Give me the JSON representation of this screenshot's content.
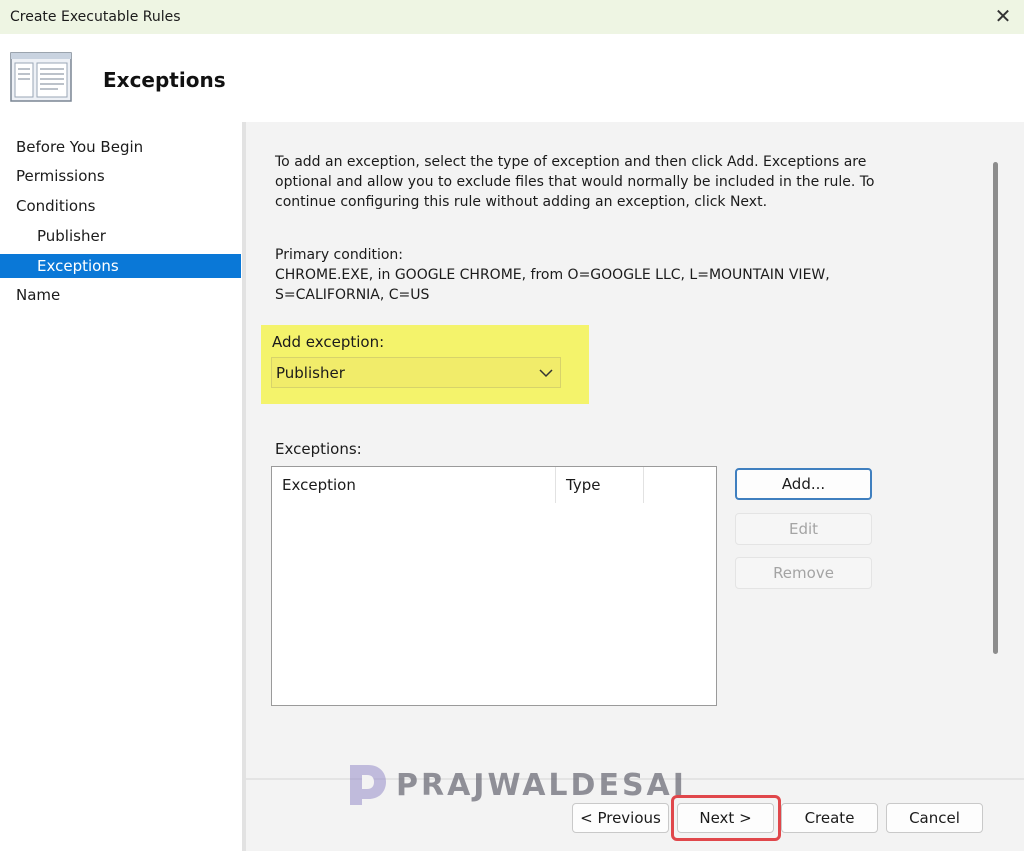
{
  "window": {
    "title": "Create Executable Rules",
    "close_glyph": "✕"
  },
  "header": {
    "title": "Exceptions",
    "icon": "wizard-page-icon"
  },
  "nav": {
    "items": [
      {
        "label": "Before You Begin",
        "level": 1,
        "active": false
      },
      {
        "label": "Permissions",
        "level": 1,
        "active": false
      },
      {
        "label": "Conditions",
        "level": 1,
        "active": false
      },
      {
        "label": "Publisher",
        "level": 2,
        "active": false
      },
      {
        "label": "Exceptions",
        "level": 2,
        "active": true
      },
      {
        "label": "Name",
        "level": 1,
        "active": false
      }
    ]
  },
  "main": {
    "intro": "To add an exception, select the type of exception and then click Add. Exceptions are optional and allow you to exclude files that would normally be included in the rule. To continue configuring this rule without adding an exception, click Next.",
    "primary_condition_label": "Primary condition:",
    "primary_condition_value": "CHROME.EXE, in GOOGLE CHROME, from O=GOOGLE LLC, L=MOUNTAIN VIEW, S=CALIFORNIA, C=US",
    "add_exception_label": "Add exception:",
    "add_exception_selected": "Publisher",
    "exceptions_label": "Exceptions:",
    "columns": [
      "Exception",
      "Type"
    ],
    "buttons": {
      "add": "Add...",
      "edit": "Edit",
      "remove": "Remove"
    }
  },
  "footer": {
    "previous": "< Previous",
    "next": "Next >",
    "create": "Create",
    "cancel": "Cancel"
  },
  "watermark": {
    "text": "PRAJWALDESAI"
  },
  "colors": {
    "titlebar": "#eef5e3",
    "nav_active": "#0a78d7",
    "highlight": "#f4f36b",
    "next_ring": "#e0474b",
    "primary_button_border": "#3f7fbf"
  }
}
